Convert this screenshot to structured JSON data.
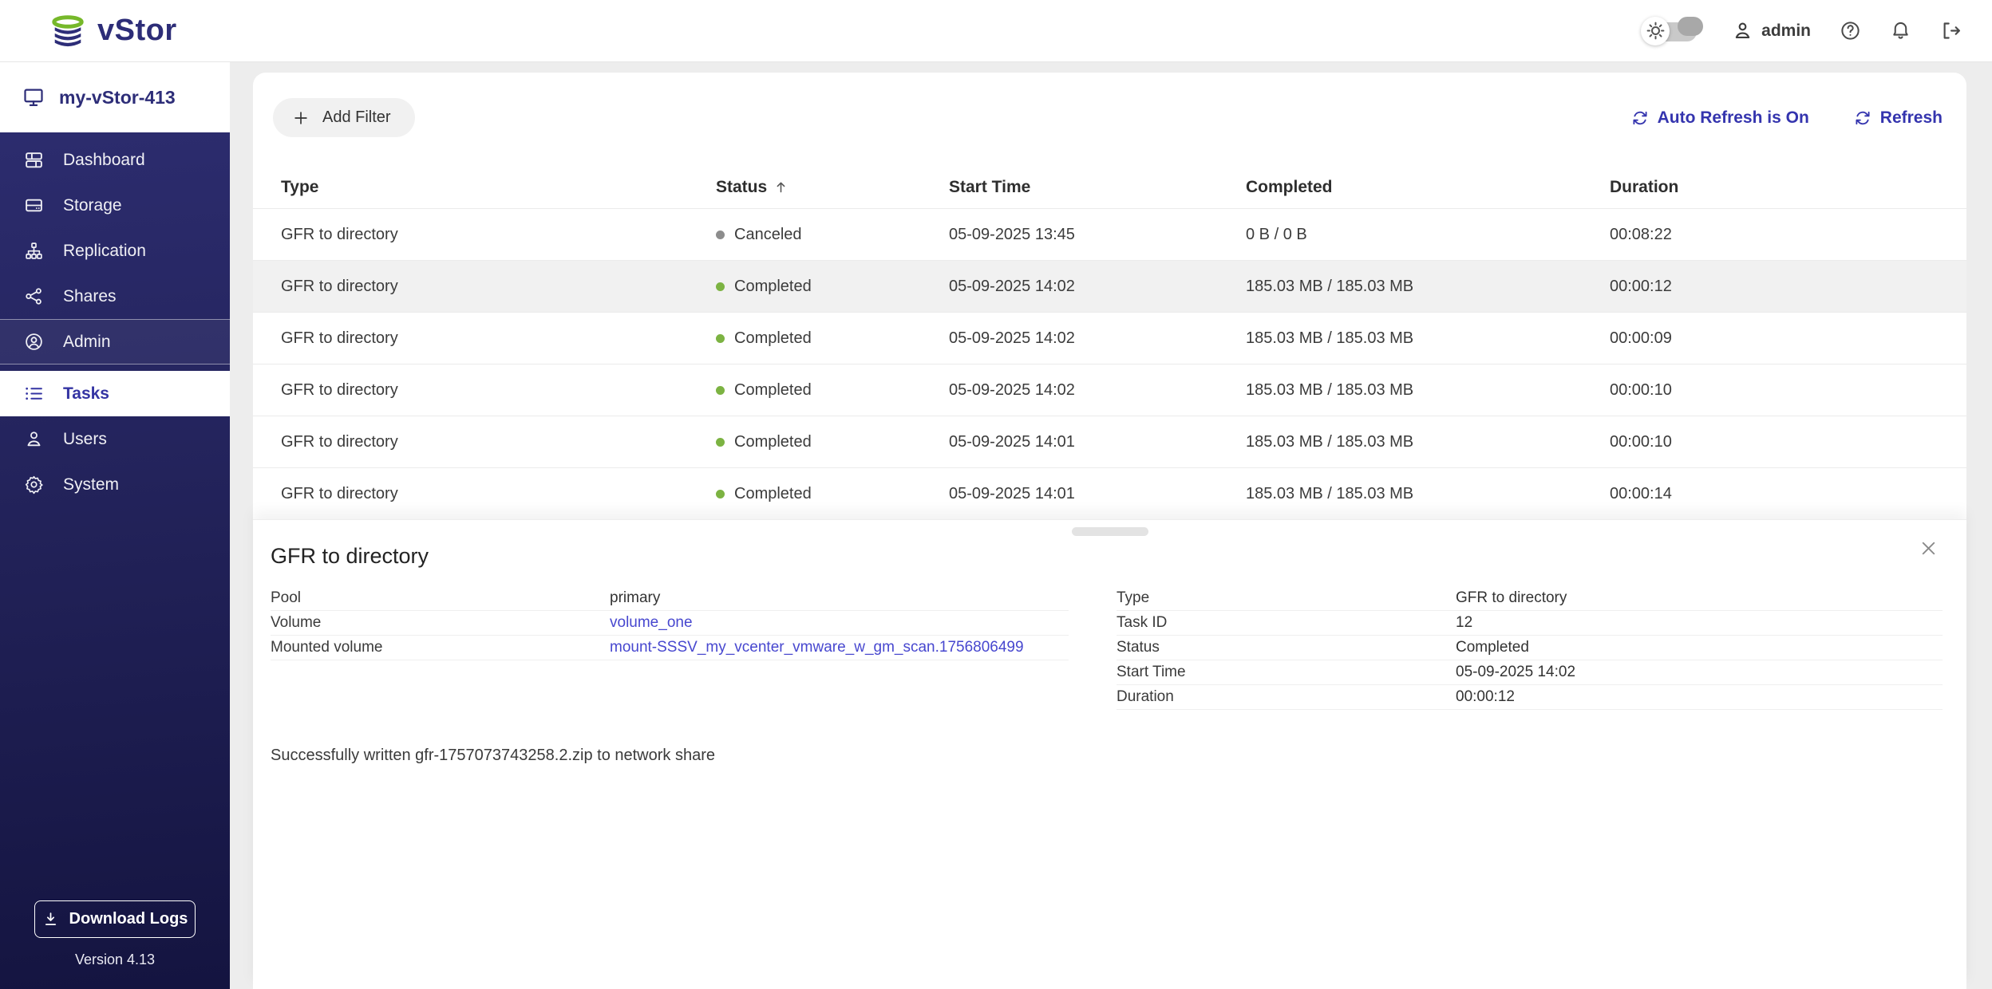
{
  "header": {
    "logo_text": "vStor",
    "user": "admin"
  },
  "sidebar": {
    "hostname": "my-vStor-413",
    "items": [
      {
        "label": "Dashboard"
      },
      {
        "label": "Storage"
      },
      {
        "label": "Replication"
      },
      {
        "label": "Shares"
      },
      {
        "label": "Admin"
      },
      {
        "label": "Tasks"
      },
      {
        "label": "Users"
      },
      {
        "label": "System"
      }
    ],
    "download_logs_label": "Download Logs",
    "version": "Version 4.13"
  },
  "toolbar": {
    "add_filter_label": "Add Filter",
    "auto_refresh_label": "Auto Refresh is On",
    "refresh_label": "Refresh"
  },
  "table": {
    "columns": [
      "Type",
      "Status",
      "Start Time",
      "Completed",
      "Duration"
    ],
    "sorted_column": "Status",
    "sort_direction": "asc",
    "rows": [
      {
        "type": "GFR to directory",
        "status": "Canceled",
        "start_time": "05-09-2025 13:45",
        "completed": "0 B / 0 B",
        "duration": "00:08:22",
        "selected": false
      },
      {
        "type": "GFR to directory",
        "status": "Completed",
        "start_time": "05-09-2025 14:02",
        "completed": "185.03 MB / 185.03 MB",
        "duration": "00:00:12",
        "selected": true
      },
      {
        "type": "GFR to directory",
        "status": "Completed",
        "start_time": "05-09-2025 14:02",
        "completed": "185.03 MB / 185.03 MB",
        "duration": "00:00:09",
        "selected": false
      },
      {
        "type": "GFR to directory",
        "status": "Completed",
        "start_time": "05-09-2025 14:02",
        "completed": "185.03 MB / 185.03 MB",
        "duration": "00:00:10",
        "selected": false
      },
      {
        "type": "GFR to directory",
        "status": "Completed",
        "start_time": "05-09-2025 14:01",
        "completed": "185.03 MB / 185.03 MB",
        "duration": "00:00:10",
        "selected": false
      },
      {
        "type": "GFR to directory",
        "status": "Completed",
        "start_time": "05-09-2025 14:01",
        "completed": "185.03 MB / 185.03 MB",
        "duration": "00:00:14",
        "selected": false
      }
    ]
  },
  "detail_panel": {
    "title": "GFR to directory",
    "left_fields": [
      {
        "label": "Pool",
        "value": "primary"
      },
      {
        "label": "Volume",
        "value": "volume_one"
      },
      {
        "label": "Mounted volume",
        "value": "mount-SSSV_my_vcenter_vmware_w_gm_scan.1756806499"
      }
    ],
    "right_fields": [
      {
        "label": "Type",
        "value": "GFR to directory"
      },
      {
        "label": "Task ID",
        "value": "12"
      },
      {
        "label": "Status",
        "value": "Completed"
      },
      {
        "label": "Start Time",
        "value": "05-09-2025 14:02"
      },
      {
        "label": "Duration",
        "value": "00:00:12"
      }
    ],
    "message": "Successfully written gfr-1757073743258.2.zip to network share"
  },
  "colors": {
    "navy": "#2d2d78",
    "accent_blue": "#3434ae",
    "link_blue": "#4747cf",
    "status_completed": "#7cb342",
    "status_canceled": "#8d8d8d"
  }
}
